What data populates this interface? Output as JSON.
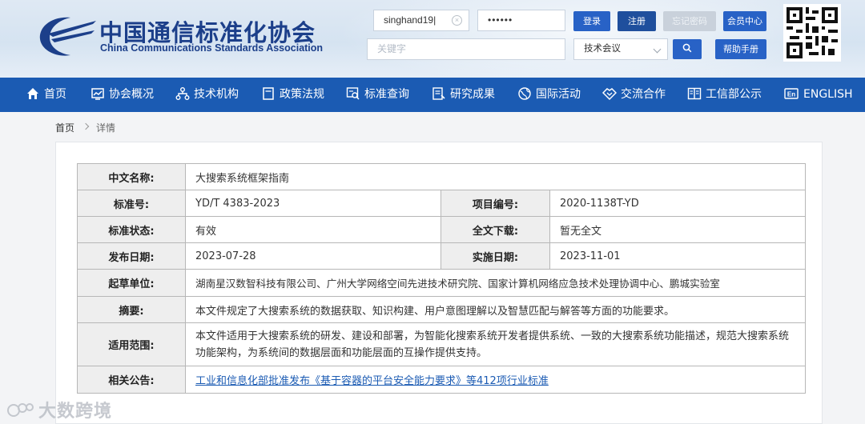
{
  "site": {
    "name_cn": "中国通信标准化协会",
    "name_en": "China Communications Standards Association"
  },
  "login": {
    "username_value": "singhand19",
    "password_mask": "••••••",
    "login_label": "登录",
    "register_label": "注册",
    "forgot_label": "忘记密码",
    "member_label": "会员中心"
  },
  "search": {
    "placeholder": "关键字",
    "category_selected": "技术会议",
    "help_label": "帮助手册"
  },
  "nav": [
    {
      "label": "首页",
      "icon": "home-icon"
    },
    {
      "label": "协会概况",
      "icon": "chart-icon"
    },
    {
      "label": "技术机构",
      "icon": "org-icon"
    },
    {
      "label": "政策法规",
      "icon": "doc-icon"
    },
    {
      "label": "标准查询",
      "icon": "search-doc-icon"
    },
    {
      "label": "研究成果",
      "icon": "research-icon"
    },
    {
      "label": "国际活动",
      "icon": "globe-icon"
    },
    {
      "label": "交流合作",
      "icon": "handshake-icon"
    },
    {
      "label": "工信部公示",
      "icon": "book-icon"
    },
    {
      "label": "ENGLISH",
      "icon": "en-icon"
    }
  ],
  "breadcrumb": {
    "home": "首页",
    "current": "详情"
  },
  "detail": {
    "name_label": "中文名称:",
    "name_value": "大搜索系统框架指南",
    "std_no_label": "标准号:",
    "std_no_value": "YD/T 4383-2023",
    "project_no_label": "项目编号:",
    "project_no_value": "2020-1138T-YD",
    "status_label": "标准状态:",
    "status_value": "有效",
    "download_label": "全文下载:",
    "download_value": "暂无全文",
    "publish_label": "发布日期:",
    "publish_value": "2023-07-28",
    "implement_label": "实施日期:",
    "implement_value": "2023-11-01",
    "drafter_label": "起草单位:",
    "drafter_value": "湖南星汉数智科技有限公司、广州大学网络空间先进技术研究院、国家计算机网络应急技术处理协调中心、鹏城实验室",
    "abstract_label": "摘要:",
    "abstract_value": "本文件规定了大搜索系统的数据获取、知识构建、用户意图理解以及智慧匹配与解答等方面的功能要求。",
    "scope_label": "适用范围:",
    "scope_value": "本文件适用于大搜索系统的研发、建设和部署，为智能化搜索系统开发者提供系统、一致的大搜索系统功能描述，规范大搜索系统功能架构，为系统间的数据层面和功能层面的互操作提供支持。",
    "notice_label": "相关公告:",
    "notice_value": "工业和信息化部批准发布《基于容器的平台安全能力要求》等412项行业标准"
  },
  "watermark": "大数跨境",
  "colors": {
    "nav_bg": "#1b5bb3",
    "brand": "#1c3f8a",
    "button_blue": "#2862c6"
  }
}
